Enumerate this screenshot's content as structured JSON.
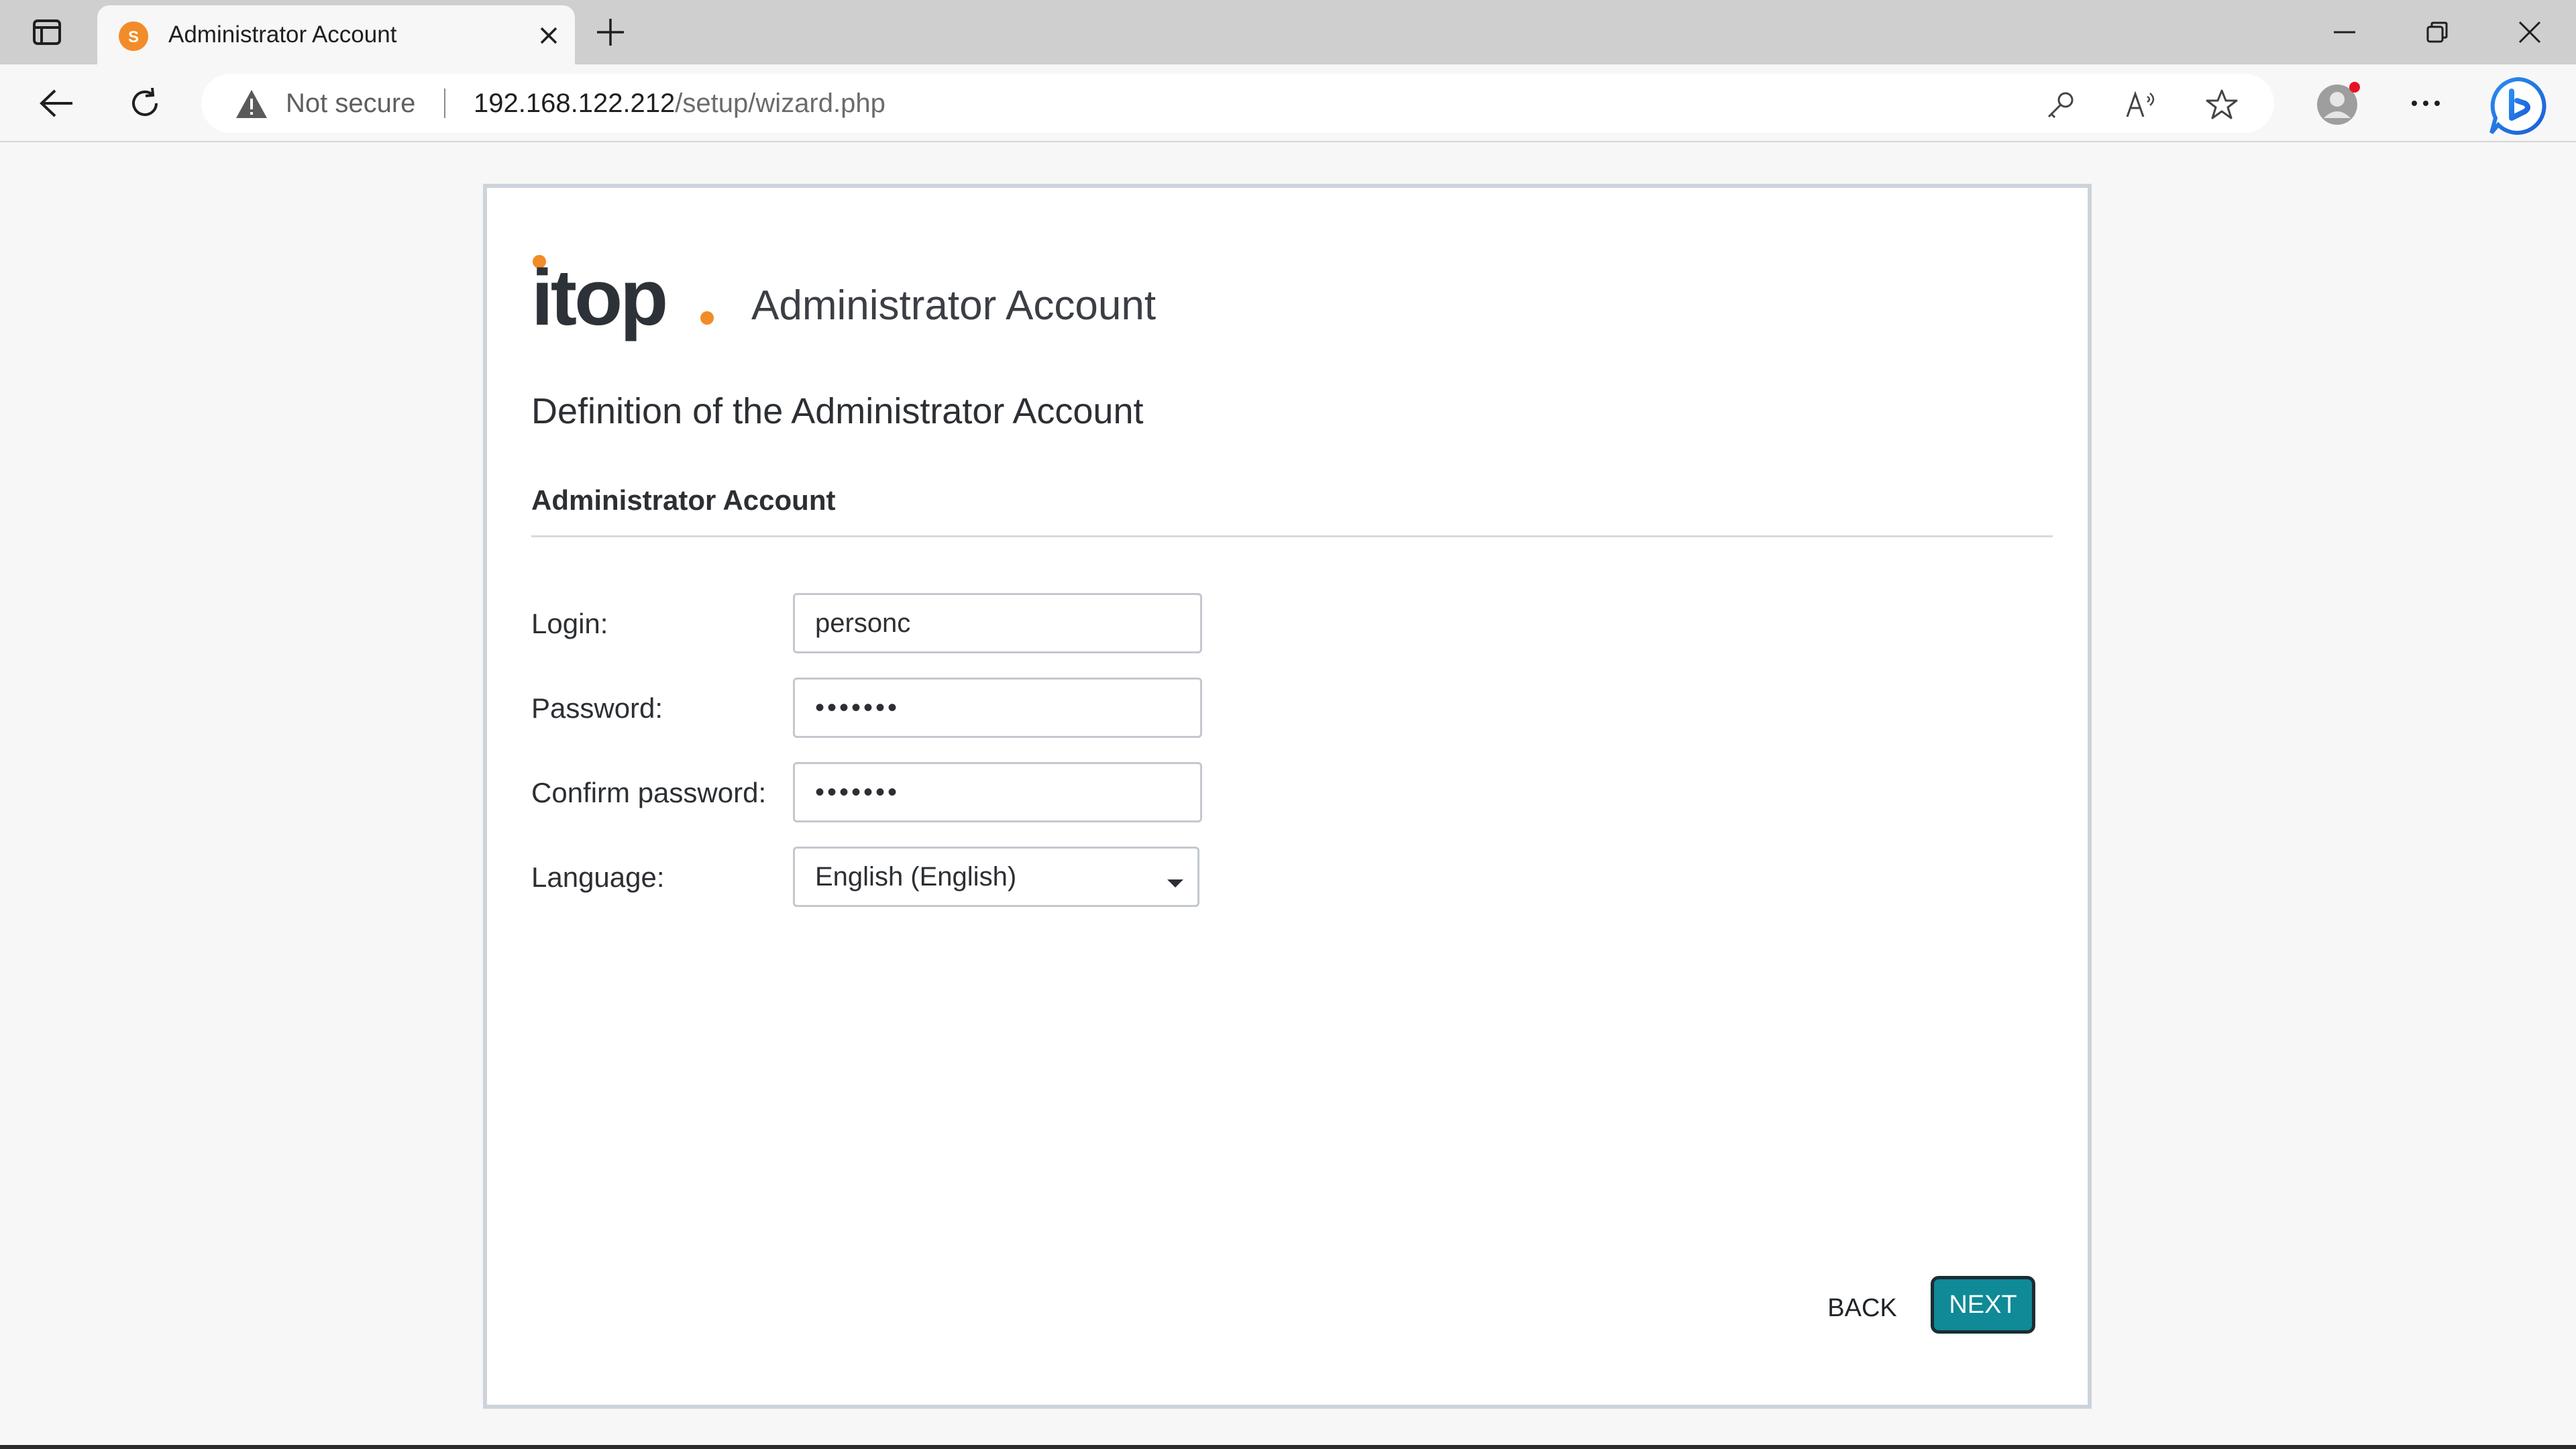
{
  "browser": {
    "tab": {
      "title": "Administrator Account",
      "favicon_icon": "itop-favicon-icon",
      "favicon_color": "#f28c28"
    },
    "address_bar": {
      "security_label": "Not secure",
      "url_host": "192.168.122.212",
      "url_path": "/setup/wizard.php"
    },
    "profile_notification_color": "#e81123",
    "icons": [
      "tab-actions-icon",
      "close-icon",
      "plus-icon",
      "minimize-icon",
      "restore-icon",
      "window-close-icon",
      "back-arrow-icon",
      "refresh-icon",
      "warning-icon",
      "key-icon",
      "read-aloud-icon",
      "favorite-star-icon",
      "profile-icon",
      "more-icon",
      "bing-icon"
    ]
  },
  "wizard": {
    "logo_text": "itop",
    "logo_accent_color": "#f28c28",
    "header_title": "Administrator Account",
    "subtitle": "Definition of the Administrator Account",
    "section_title": "Administrator Account",
    "fields": {
      "login": {
        "label": "Login:",
        "value": "personc"
      },
      "password": {
        "label": "Password:",
        "value": "•••••••"
      },
      "confirm_password": {
        "label": "Confirm password:",
        "value": "•••••••"
      },
      "language": {
        "label": "Language:",
        "value": "English (English)"
      }
    },
    "buttons": {
      "back": "BACK",
      "next": "NEXT"
    },
    "accent_color": "#0f8a96"
  }
}
